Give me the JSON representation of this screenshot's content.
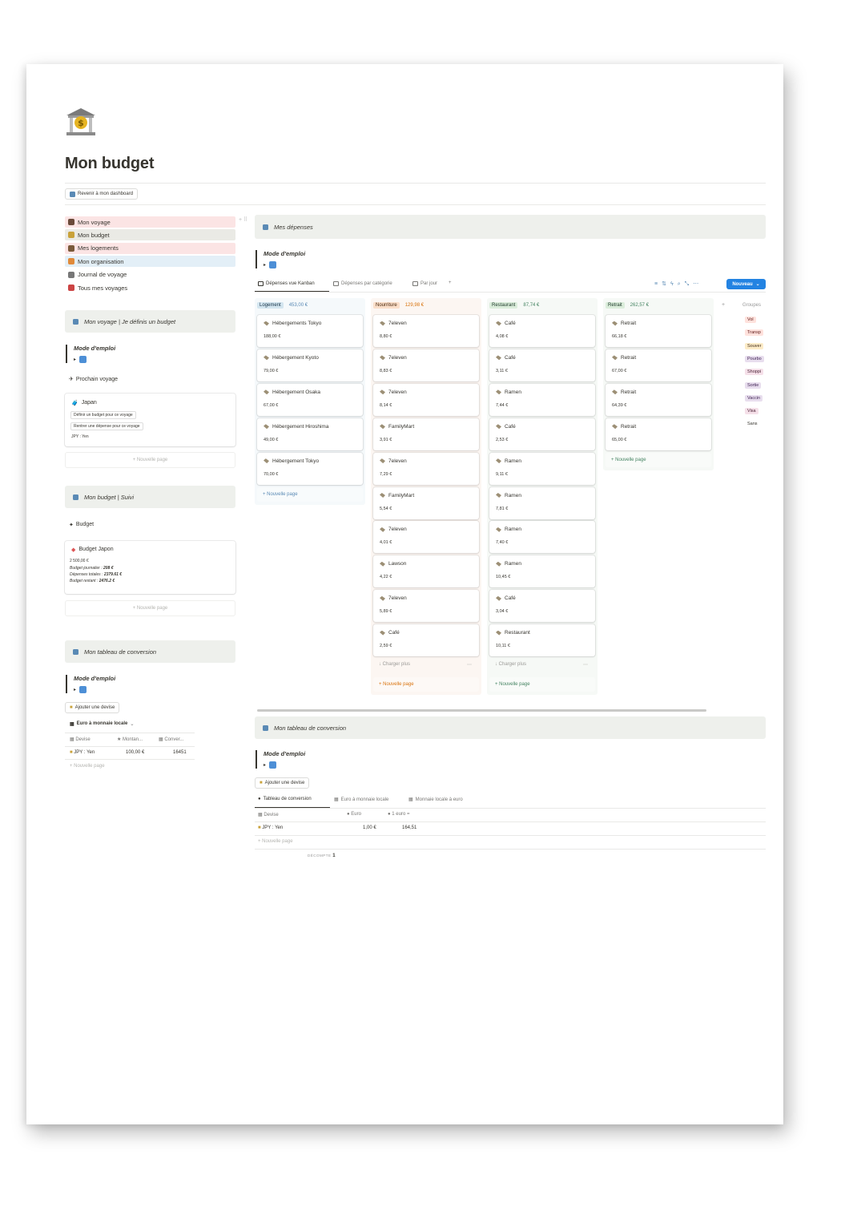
{
  "page": {
    "title": "Mon budget",
    "back_button": "Revenir à mon dashboard"
  },
  "nav": [
    {
      "label": "Mon voyage",
      "bg": "#fbe4e4",
      "icon": "luggage-icon",
      "icon_color": "#6b4a3a"
    },
    {
      "label": "Mon budget",
      "bg": "#eaeae5",
      "icon": "bank-icon",
      "icon_color": "#c9a23a"
    },
    {
      "label": "Mes logements",
      "bg": "#fbe4e4",
      "icon": "house-icon",
      "icon_color": "#7a5a3a"
    },
    {
      "label": "Mon organisation",
      "bg": "#e3eff7",
      "icon": "calendar-icon",
      "icon_color": "#e08a3a"
    },
    {
      "label": "Journal de voyage",
      "bg": "",
      "icon": "newspaper-icon",
      "icon_color": "#777"
    },
    {
      "label": "Tous mes voyages",
      "bg": "",
      "icon": "car-icon",
      "icon_color": "#c44"
    }
  ],
  "left": {
    "callout1": "Mon voyage | Je définis un budget",
    "mode": "Mode d'emploi",
    "prochain": "Prochain voyage",
    "trip_card": {
      "name": "Japan",
      "items": [
        "Définir un budget pour ce voyage",
        "Rentrer une dépense pour ce voyage",
        "JPY : Yen"
      ]
    },
    "new_page": "+ Nouvelle page",
    "callout2": "Mon budget | Suivi",
    "budget_label": "Budget",
    "budget_card": {
      "name": "Budget Japon",
      "amount": "2 500,00 €",
      "daily_label": "Budget journalier :",
      "daily_value": "208 €",
      "total_label": "Dépenses totales :",
      "total_value": "2379.61 €",
      "rest_label": "Budget restant :",
      "rest_value": "2476.2 €"
    },
    "callout3": "Mon tableau de conversion",
    "add_currency": "Ajouter une devise",
    "euro_local": "Euro à monnaie locale",
    "table": {
      "headers": [
        "Devise",
        "Montan...",
        "Conver..."
      ],
      "row": [
        "JPY : Yen",
        "100,00 €",
        "16451"
      ]
    },
    "new_page_small": "+ Nouvelle page"
  },
  "main": {
    "callout": "Mes dépenses",
    "mode": "Mode d'emploi",
    "tabs": [
      "Dépenses vue Kanban",
      "Dépenses par catégorie",
      "Par jour",
      "+"
    ],
    "new_button": "Nouveau",
    "columns": [
      {
        "name": "Logement",
        "total": "453,00 €",
        "tag_bg": "#d3e5ef",
        "tag_color": "#183347",
        "total_color": "#5a8ab5",
        "bg": "#f5f9fb",
        "cards": [
          [
            "Hébergements Tokyo",
            "188,00 €"
          ],
          [
            "Hébergement Kyoto",
            "79,00 €"
          ],
          [
            "Hébergement Osaka",
            "67,00 €"
          ],
          [
            "Hébergement Hiroshima",
            "49,00 €"
          ],
          [
            "Hébergement Tokyo",
            "70,00 €"
          ]
        ],
        "more": "",
        "new": "+ Nouvelle page",
        "new_color": "#5a8ab5"
      },
      {
        "name": "Nourriture",
        "total": "129,98 €",
        "tag_bg": "#fadec9",
        "tag_color": "#49290e",
        "total_color": "#d9730d",
        "bg": "#fcf6f2",
        "cards": [
          [
            "7eleven",
            "8,80 €"
          ],
          [
            "7eleven",
            "8,83 €"
          ],
          [
            "7eleven",
            "8,14 €"
          ],
          [
            "FamilyMart",
            "3,91 €"
          ],
          [
            "7eleven",
            "7,29 €"
          ],
          [
            "FamilyMart",
            "5,54 €"
          ],
          [
            "7eleven",
            "4,01 €"
          ],
          [
            "Lawson",
            "4,22 €"
          ],
          [
            "7eleven",
            "5,89 €"
          ],
          [
            "Café",
            "2,59 €"
          ]
        ],
        "more": "↓ Charger plus",
        "new": "+ Nouvelle page",
        "new_color": "#d9730d"
      },
      {
        "name": "Restaurant",
        "total": "87,74 €",
        "tag_bg": "#dbeddb",
        "tag_color": "#1c3829",
        "total_color": "#448361",
        "bg": "#f6f9f6",
        "cards": [
          [
            "Café",
            "4,08 €"
          ],
          [
            "Café",
            "3,11 €"
          ],
          [
            "Ramen",
            "7,44 €"
          ],
          [
            "Café",
            "2,53 €"
          ],
          [
            "Ramen",
            "9,11 €"
          ],
          [
            "Ramen",
            "7,81 €"
          ],
          [
            "Ramen",
            "7,40 €"
          ],
          [
            "Ramen",
            "10,45 €"
          ],
          [
            "Café",
            "3,04 €"
          ],
          [
            "Restaurant",
            "10,11 €"
          ]
        ],
        "more": "↓ Charger plus",
        "new": "+ Nouvelle page",
        "new_color": "#448361"
      },
      {
        "name": "Retrait",
        "total": "262,57 €",
        "tag_bg": "#dbeddb",
        "tag_color": "#1c3829",
        "total_color": "#448361",
        "bg": "#f6f9f6",
        "cards": [
          [
            "Retrait",
            "66,18 €"
          ],
          [
            "Retrait",
            "67,00 €"
          ],
          [
            "Retrait",
            "64,39 €"
          ],
          [
            "Retrait",
            "65,00 €"
          ]
        ],
        "more": "",
        "new": "+ Nouvelle page",
        "new_color": "#448361"
      }
    ],
    "groups_label": "Groupes",
    "groups": [
      {
        "label": "Vol",
        "bg": "#ffe2dd",
        "color": "#5d1715"
      },
      {
        "label": "Transp",
        "bg": "#ffe2dd",
        "color": "#5d1715"
      },
      {
        "label": "Souver",
        "bg": "#fdecc8",
        "color": "#402c1b"
      },
      {
        "label": "Pourbo",
        "bg": "#e8deee",
        "color": "#412454"
      },
      {
        "label": "Shoppi",
        "bg": "#f5e0e9",
        "color": "#4c2337"
      },
      {
        "label": "Sortie",
        "bg": "#e8deee",
        "color": "#412454"
      },
      {
        "label": "Vaccin",
        "bg": "#e8deee",
        "color": "#412454"
      },
      {
        "label": "Visa",
        "bg": "#f5e0e9",
        "color": "#4c2337"
      },
      {
        "label": "Sans",
        "bg": "",
        "color": "#37352f"
      }
    ],
    "conv": {
      "callout": "Mon tableau de conversion",
      "mode": "Mode d'emploi",
      "add_currency": "Ajouter une devise",
      "tabs": [
        "Tableau de conversion",
        "Euro à monnaie locale",
        "Monnaie locale à euro"
      ],
      "headers": [
        "Devise",
        "Euro",
        "1 euro ="
      ],
      "row": [
        "JPY : Yen",
        "1,00 €",
        "164,51"
      ],
      "new_page": "+ Nouvelle page",
      "count_label": "DÉCOMPTE",
      "count_value": "1"
    }
  }
}
